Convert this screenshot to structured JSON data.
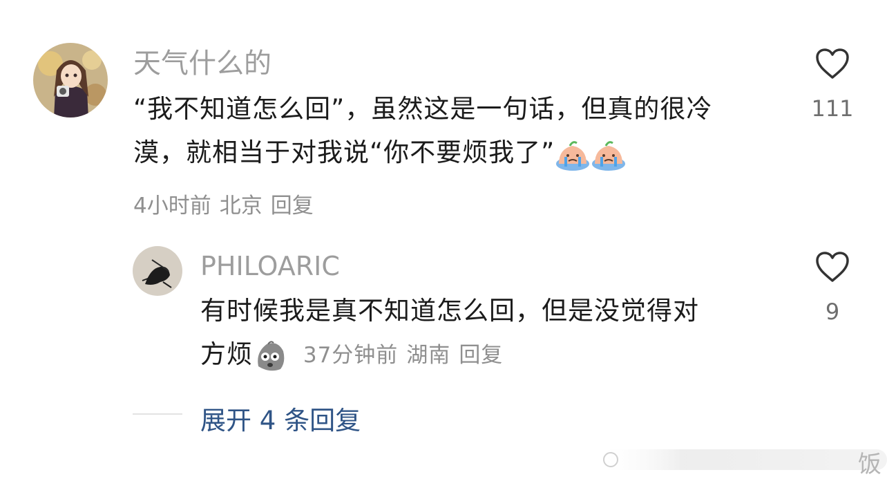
{
  "comments": [
    {
      "username": "天气什么的",
      "text_line1": "“我不知道怎么回”，虽然这是一句话，但真的很冷",
      "text_line2": "漠，就相当于对我说“你不要烦我了”",
      "emojis": [
        "crying-emoji",
        "crying-emoji"
      ],
      "time": "4小时前",
      "location": "北京",
      "reply_label": "回复",
      "like_count": "111"
    }
  ],
  "reply": {
    "username": "PHILOARIC",
    "text_line1": "有时候我是真不知道怎么回，但是没觉得对",
    "text_line2": "方烦",
    "emoji": "shocked-potato-emoji",
    "time": "37分钟前",
    "location": "湖南",
    "reply_label": "回复",
    "like_count": "9"
  },
  "expand_label": "展开 4 条回复",
  "watermark": "饭",
  "colors": {
    "username": "#9d9d9d",
    "text": "#1b1b1b",
    "meta": "#8f8f8f",
    "expand": "#2f5486"
  }
}
